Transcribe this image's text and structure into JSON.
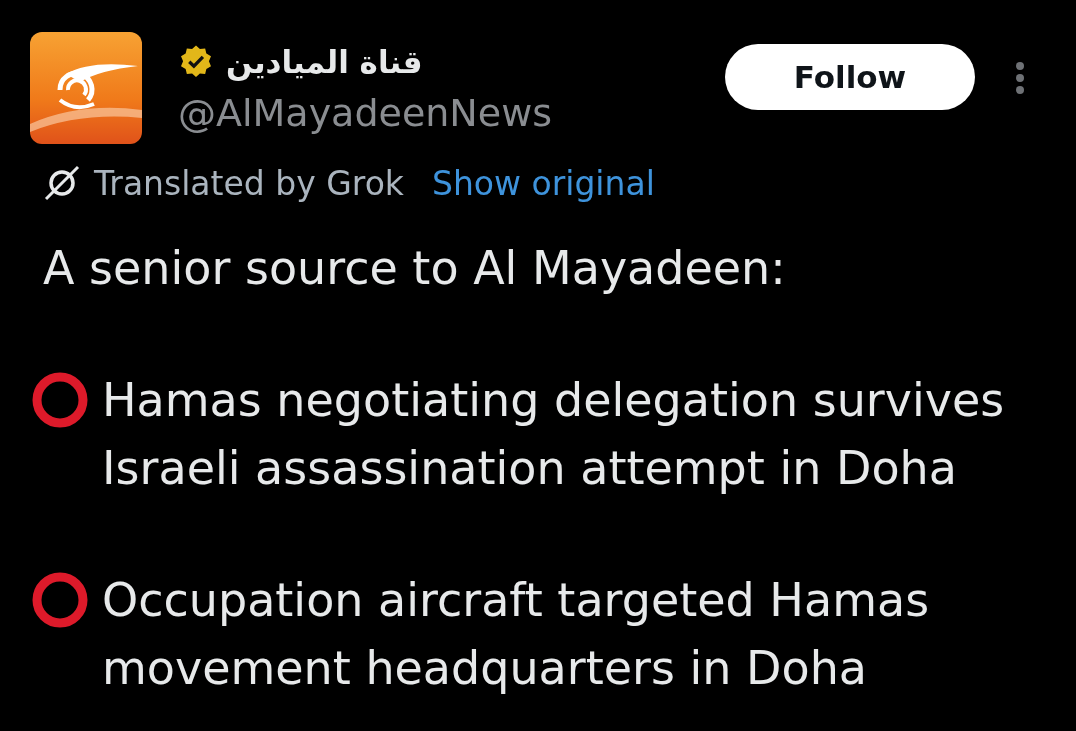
{
  "account": {
    "display_name": "قناة الميادين",
    "verified": true,
    "handle": "@AlMayadeenNews"
  },
  "follow_button": {
    "label": "Follow"
  },
  "translation": {
    "label": "Translated by Grok",
    "link": "Show original"
  },
  "post": {
    "intro": "A senior source to Al Mayadeen:",
    "items": [
      {
        "text": "Hamas negotiating delegation survives Israeli assassination attempt in Doha"
      },
      {
        "text": "Occupation aircraft targeted Hamas movement headquarters in Doha"
      }
    ]
  }
}
